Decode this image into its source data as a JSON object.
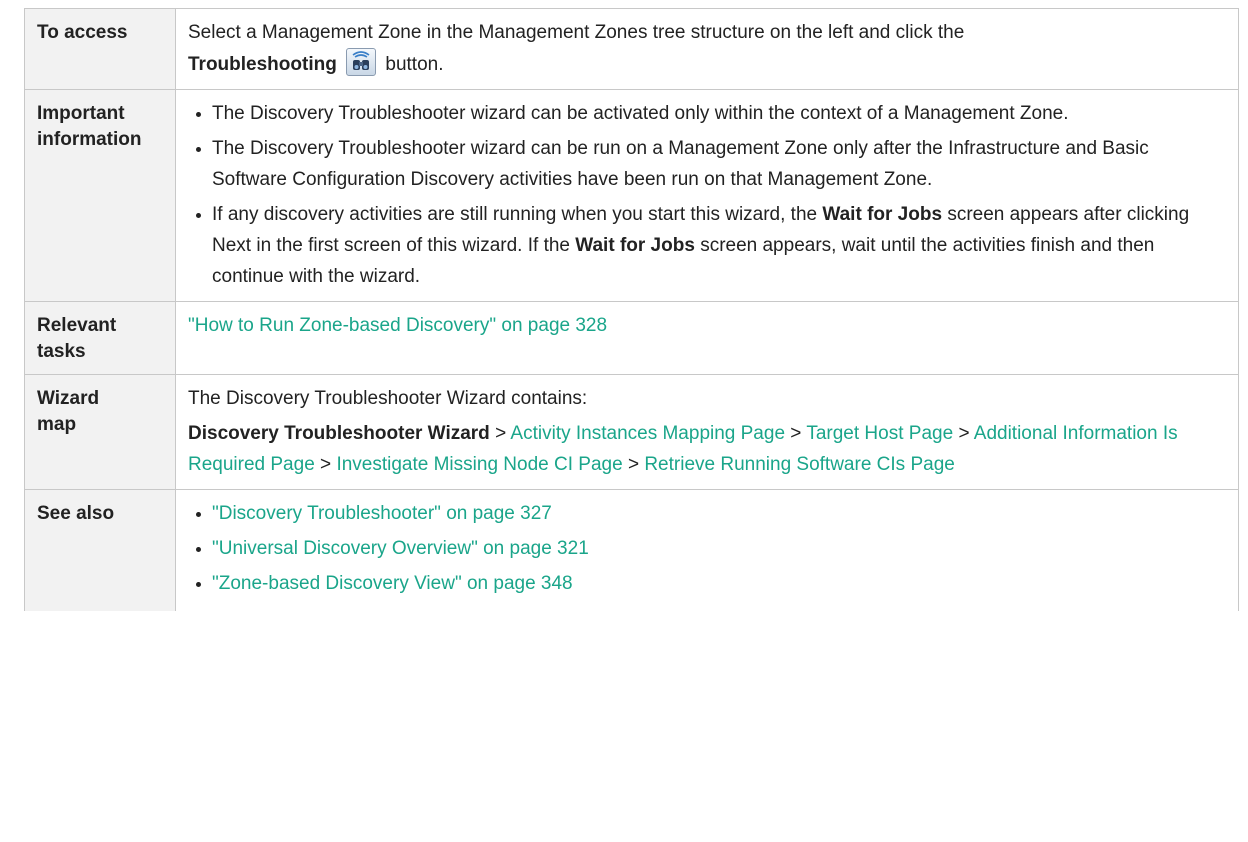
{
  "rows": {
    "access": {
      "label": "To access",
      "text_before": "Select a Management Zone in the Management Zones tree structure on the left and click the",
      "button_label": "Troubleshooting",
      "text_after": "button.",
      "icon": "troubleshooting-binoculars-icon"
    },
    "important": {
      "label_line1": "Important",
      "label_line2": "information",
      "bullet1": "The Discovery Troubleshooter wizard can be activated only within the context of a Management Zone.",
      "bullet2": "The Discovery Troubleshooter wizard can be run on a Management Zone only after the Infrastructure and Basic Software Configuration Discovery activities have been run on that Management Zone.",
      "bullet3_a": "If any discovery activities are still running when you start this wizard, the",
      "bullet3_b": "Wait for Jobs",
      "bullet3_c": "screen appears after clicking Next in the first screen of this wizard. If the",
      "bullet3_d": "Wait for Jobs",
      "bullet3_e": "screen appears, wait until the activities finish and then continue with the wizard."
    },
    "tasks": {
      "label_line1": "Relevant",
      "label_line2": "tasks",
      "link": "\"How to Run Zone-based Discovery\" on page 328"
    },
    "wizard": {
      "label_line1": "Wizard",
      "label_line2": "map",
      "intro": "The Discovery Troubleshooter Wizard contains:",
      "start": "Discovery Troubleshooter Wizard",
      "sep": ">",
      "pages": [
        "Activity Instances Mapping Page",
        "Target Host Page",
        "Additional Information Is Required Page",
        "Investigate Missing Node CI Page",
        "Retrieve Running Software CIs Page"
      ]
    },
    "see_also": {
      "label": "See also",
      "links": [
        "\"Discovery Troubleshooter\" on page 327",
        "\"Universal Discovery Overview\" on page 321",
        "\"Zone-based Discovery View\" on page 348"
      ]
    }
  },
  "colors": {
    "link": "#1aa58a",
    "label_bg": "#f2f2f2",
    "border": "#c8c8c8"
  }
}
